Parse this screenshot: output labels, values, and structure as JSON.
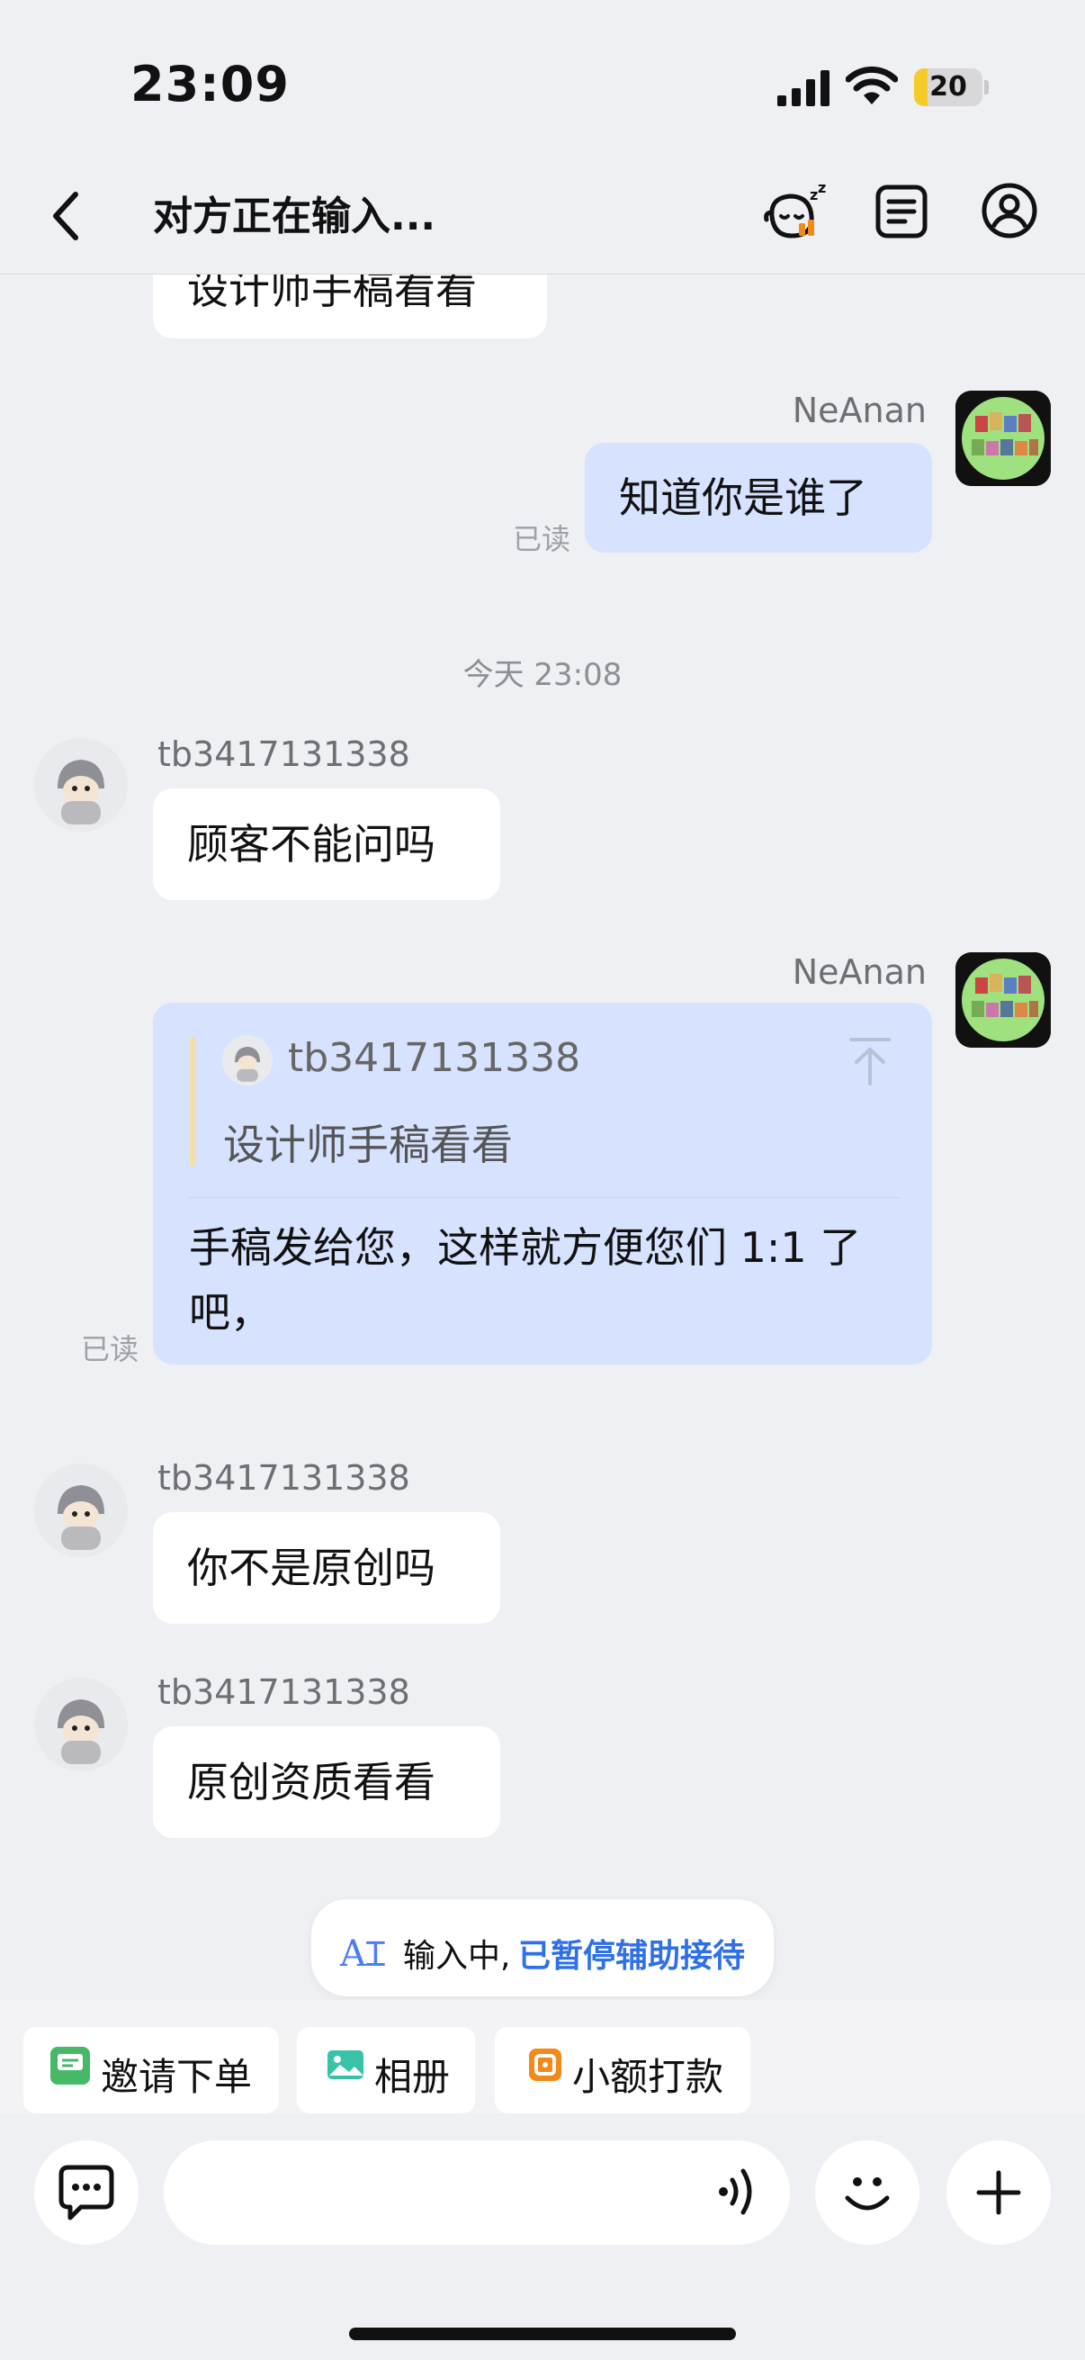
{
  "status_bar": {
    "time": "23:09",
    "battery": "20",
    "battery_level": 0.2
  },
  "header": {
    "title": "对方正在输入..."
  },
  "messages": {
    "partial_top": "设计师手稿看看",
    "m1": {
      "sender": "NeAnan",
      "text": "知道你是谁了",
      "read": "已读"
    },
    "date_separator": "今天 23:08",
    "m2": {
      "sender": "tb3417131338",
      "text": "顾客不能问吗"
    },
    "m3": {
      "sender": "NeAnan",
      "quote_sender": "tb3417131338",
      "quote_text": "设计师手稿看看",
      "text": "手稿发给您，这样就方便您们 1:1 了吧，",
      "read": "已读"
    },
    "m4": {
      "sender": "tb3417131338",
      "text": "你不是原创吗"
    },
    "m5": {
      "sender": "tb3417131338",
      "text": "原创资质看看"
    }
  },
  "typing_status": {
    "icon_text": "A",
    "text": "输入中,",
    "link": "已暂停辅助接待"
  },
  "quick_actions": {
    "invite": "邀请下单",
    "album": "相册",
    "pay": "小额打款"
  },
  "colors": {
    "mine_bubble": "#d6e2fe",
    "link_blue": "#2f70e8",
    "invite_green": "#47b868",
    "album_teal": "#38c2a8",
    "pay_orange": "#f28a1a"
  }
}
